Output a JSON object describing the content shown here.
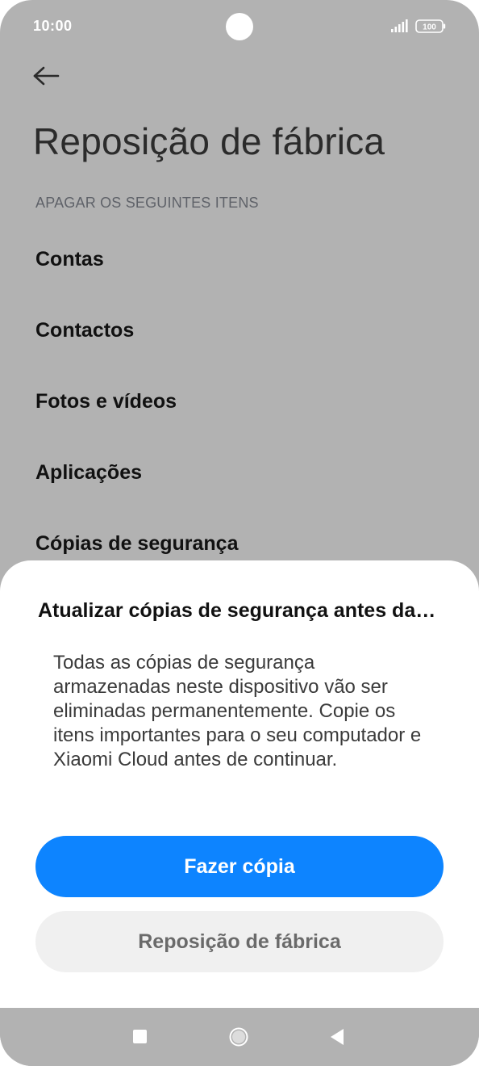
{
  "status_bar": {
    "time": "10:00",
    "battery": "100",
    "icons": [
      "camera-cutout",
      "signal-icon",
      "battery-icon"
    ]
  },
  "header": {
    "back_icon": "back-arrow-icon",
    "title": "Reposição de fábrica"
  },
  "erase_section": {
    "header": "APAGAR OS SEGUINTES ITENS",
    "items": [
      {
        "label": "Contas"
      },
      {
        "label": "Contactos"
      },
      {
        "label": "Fotos e vídeos"
      },
      {
        "label": "Aplicações"
      },
      {
        "label": "Cópias de segurança"
      }
    ]
  },
  "dialog": {
    "title": "Atualizar cópias de segurança antes da…",
    "message": "Todas as cópias de segurança armazenadas neste dispositivo vão ser eliminadas permanentemente. Copie os itens importantes para o seu computador e Xiaomi Cloud antes de continuar.",
    "primary_label": "Fazer cópia",
    "secondary_label": "Reposição de fábrica"
  },
  "nav_bar": {
    "icons": [
      "recents-icon",
      "home-icon",
      "back-icon"
    ]
  },
  "colors": {
    "scrim_background": "#b2b2b2",
    "accent": "#0d84ff",
    "secondary_button": "#f0f0f0",
    "text_primary": "#111111"
  }
}
